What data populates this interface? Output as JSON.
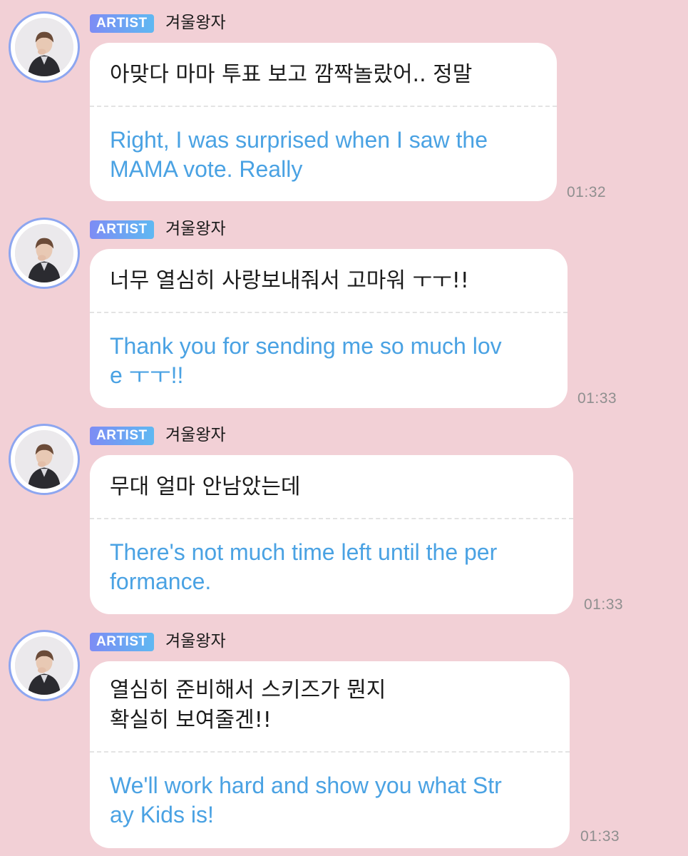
{
  "messages": [
    {
      "badge": "ARTIST",
      "name": "겨울왕자",
      "korean": "아맞다 마마 투표 보고 깜짝놀랐어.. 정말",
      "english": "Right, I was surprised when I saw the\nMAMA vote. Really",
      "time": "01:32"
    },
    {
      "badge": "ARTIST",
      "name": "겨울왕자",
      "korean": "너무 열심히 사랑보내줘서 고마워 ㅜㅜ!!",
      "english": "Thank you for sending me so much lov\ne ㅜㅜ!!",
      "time": "01:33"
    },
    {
      "badge": "ARTIST",
      "name": "겨울왕자",
      "korean": "무대 얼마 안남았는데",
      "english": "There's not much time left until the per\nformance.",
      "time": "01:33"
    },
    {
      "badge": "ARTIST",
      "name": "겨울왕자",
      "korean": "열심히 준비해서 스키즈가 뭔지\n확실히 보여줄겐!!",
      "english": "We'll work hard and show you what Str\nay Kids is!",
      "time": "01:33"
    }
  ],
  "colors": {
    "background": "#f2d0d6",
    "bubble": "#ffffff",
    "translation_text": "#4aa2e3",
    "badge_start": "#7d8cf4",
    "badge_end": "#5fb8f2",
    "avatar_ring": "#8da6f0",
    "timestamp": "#8f8f8f"
  },
  "icons": {
    "avatar": "profile-photo"
  }
}
